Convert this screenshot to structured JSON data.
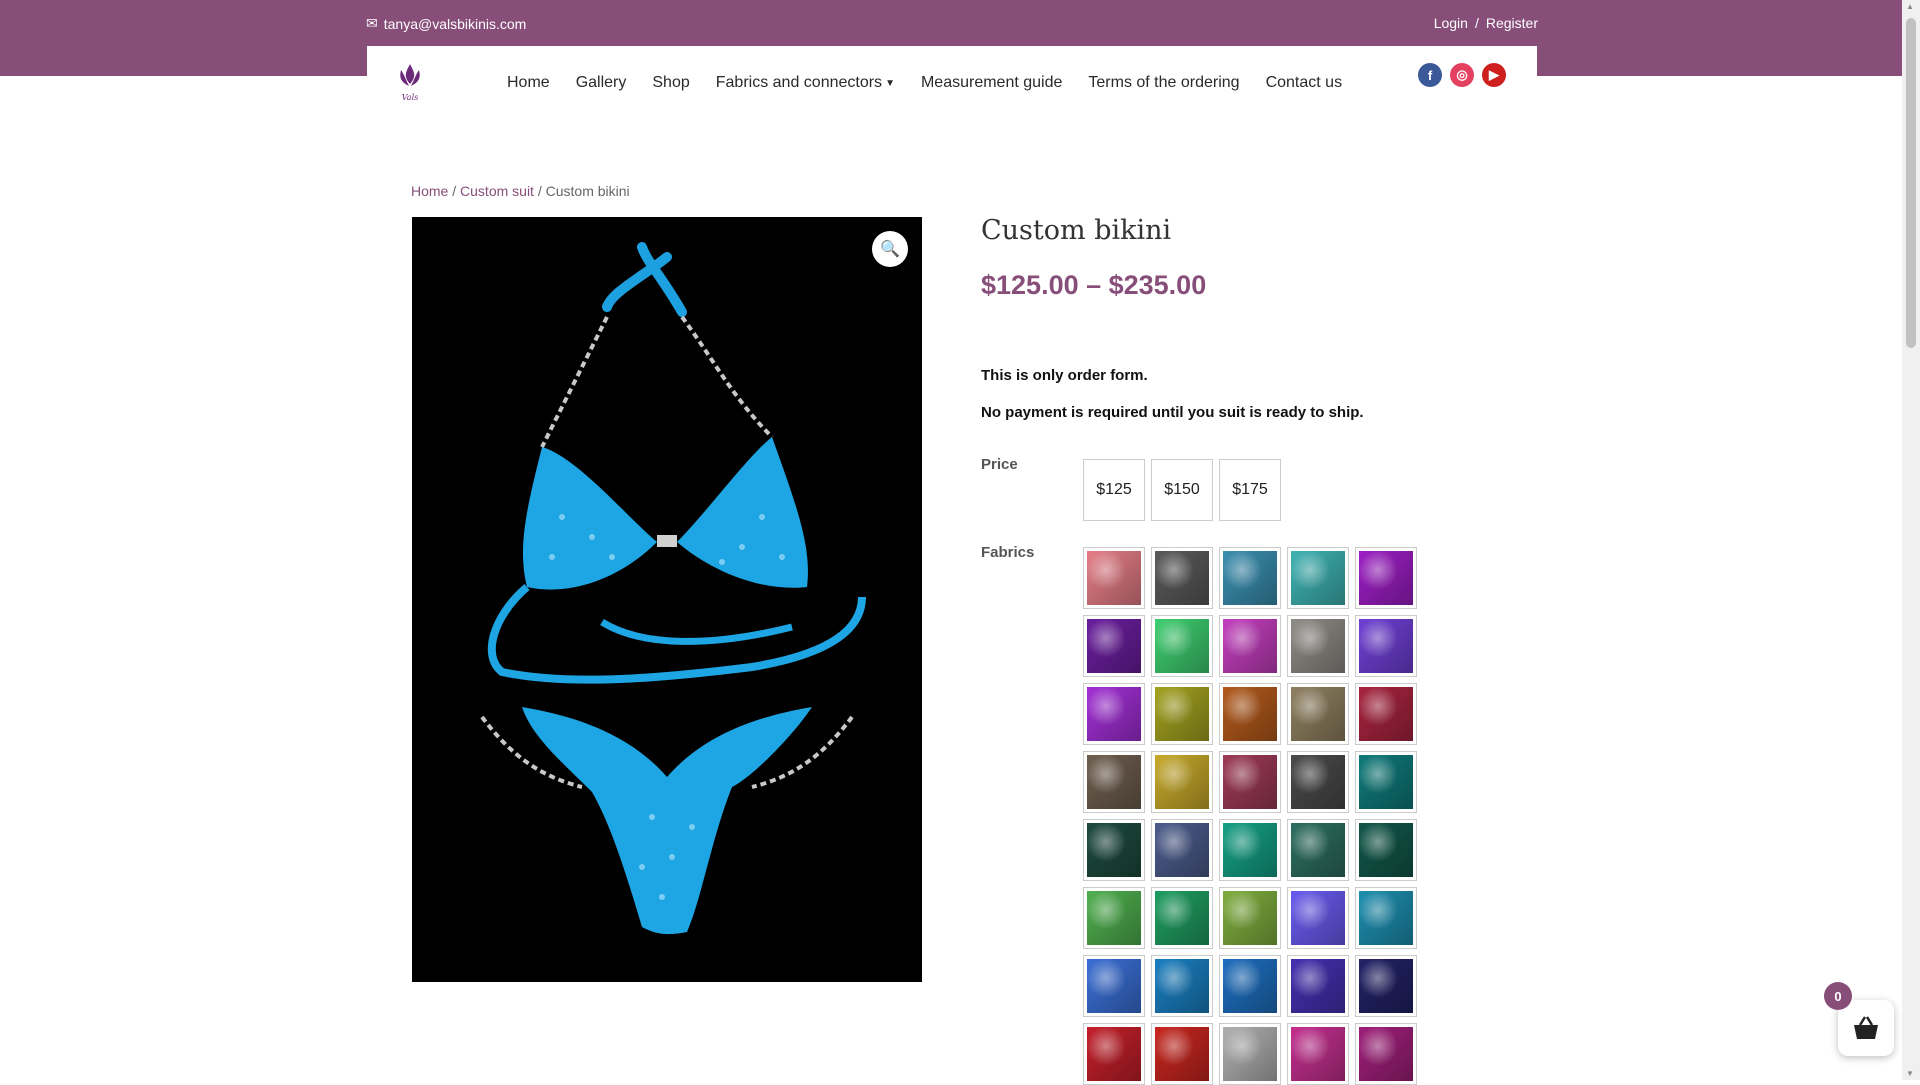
{
  "topbar": {
    "email": "tanya@valsbikinis.com",
    "login": "Login",
    "separator": "/",
    "register": "Register"
  },
  "logo": {
    "text": "Vals"
  },
  "nav": [
    "Home",
    "Gallery",
    "Shop",
    "Fabrics and connectors",
    "Measurement guide",
    "Terms of the ordering",
    "Contact us"
  ],
  "breadcrumb": {
    "home": "Home",
    "sep1": "/",
    "category": "Custom suit",
    "sep2": "/",
    "current": "Custom bikini"
  },
  "product": {
    "title": "Custom bikini",
    "price_range": "$125.00 – $235.00",
    "note1": "This is only order form.",
    "note2": "No payment is required until you suit is ready to ship.",
    "price_label": "Price",
    "price_options": [
      "$125",
      "$150",
      "$175"
    ],
    "fabrics_label": "Fabrics"
  },
  "colors": {
    "brand": "#874e79"
  },
  "fabric_swatches": [
    "#e57d86",
    "#5a5a5a",
    "#3a8fb0",
    "#3fb3b3",
    "#9d1fc4",
    "#6b1e9e",
    "#3ecf70",
    "#c43fbf",
    "#8f8b86",
    "#7040d6",
    "#a22fd6",
    "#a3a21f",
    "#b35a1c",
    "#8f8060",
    "#a8243f",
    "#6e5e4e",
    "#c7a92a",
    "#9e3a57",
    "#4a4a4a",
    "#0f7a7a",
    "#1d4a3e",
    "#4c5c8c",
    "#14a085",
    "#2d6e60",
    "#12574a",
    "#4fb04f",
    "#1f9e60",
    "#7fae3e",
    "#6a5bf0",
    "#1d8fb0",
    "#3a6fd6",
    "#1a7fc1",
    "#1e6fbf",
    "#4530b0",
    "#222266",
    "#c41f2a",
    "#c9261f",
    "#b0b0b0",
    "#c42f8f",
    "#a01f7a"
  ],
  "cart": {
    "count": "0"
  }
}
